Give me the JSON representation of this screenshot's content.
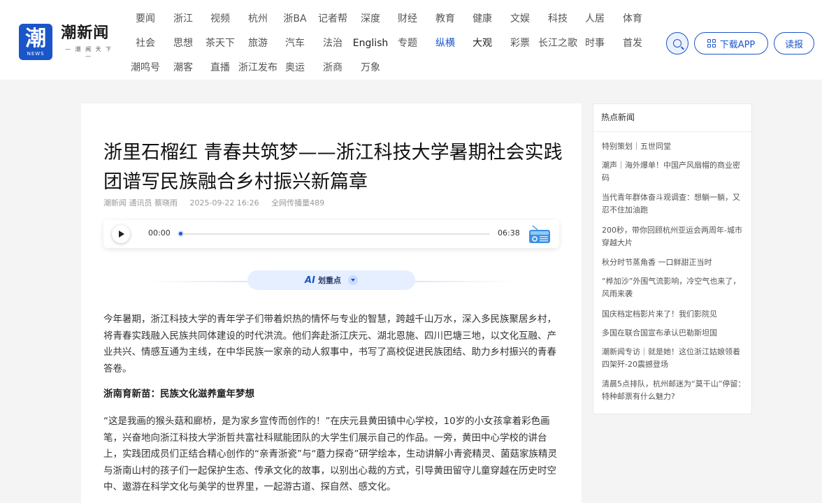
{
  "brand": {
    "logo_glyph": "潮",
    "logo_badge": "NEWS",
    "name": "潮新闻",
    "slogan": "— 潮 闻 天 下 —",
    "accent": "#1a55c9"
  },
  "nav": {
    "row1": [
      "要闻",
      "浙江",
      "视频",
      "杭州",
      "浙BA",
      "记者帮",
      "深度",
      "财经",
      "教育",
      "健康",
      "文娱",
      "科技",
      "人居",
      "体育"
    ],
    "row2": [
      "社会",
      "思想",
      "茶天下",
      "旅游",
      "汽车",
      "法治",
      "English",
      "专题",
      "纵横",
      "大观",
      "彩票",
      "长江之歌",
      "时事",
      "首发"
    ],
    "row3": [
      "潮鸣号",
      "潮客",
      "直播",
      "浙江发布",
      "奥运",
      "浙商",
      "万象"
    ],
    "active": "纵横"
  },
  "header_actions": {
    "download_label": "下载APP",
    "read_label": "读报"
  },
  "article": {
    "title": "浙里石榴红 青春共筑梦——浙江科技大学暑期社会实践团谱写民族融合乡村振兴新篇章",
    "source": "潮新闻 通讯员 蔡晓雨",
    "time": "2025-09-22 16:26",
    "reach": "全网传播量489",
    "audio": {
      "current": "00:00",
      "duration": "06:38",
      "progress": 0
    },
    "ai_label": "划重点",
    "ai_mark": "AI",
    "para1": "今年暑期，浙江科技大学的青年学子们带着炽热的情怀与专业的智慧，跨越千山万水，深入多民族聚居乡村，将青春实践融入民族共同体建设的时代洪流。他们奔赴浙江庆元、湖北恩施、四川巴塘三地，以文化互融、产业共兴、情感互通为主线，在中华民族一家亲的动人叙事中，书写了高校促进民族团结、助力乡村振兴的青春答卷。",
    "subhead1": "浙南育新苗：民族文化滋养童年梦想",
    "para2": "“这是我画的猴头菇和廊桥，是为家乡宣传而创作的！”在庆元县黄田镇中心学校，10岁的小女孩拿着彩色画笔，兴奋地向浙江科技大学浙哲共富社科赋能团队的大学生们展示自己的作品。一旁，黄田中心学校的讲台上，实践团成员们正结合精心创作的“亲青浙瓷”与“蘑力探奇”研学绘本，生动讲解小青瓷精灵、菌菇家族精灵与浙南山村的孩子们一起保护生态、传承文化的故事，以别出心裁的方式，引导黄田留守儿童穿越在历史时空中、遨游在科学文化与美学的世界里，一起游古道、探自然、感文化。"
  },
  "sidebar": {
    "title": "热点新闻",
    "items": [
      "特别策划｜五世同堂",
      "潮声｜海外爆单！中国产风扇帽的商业密码",
      "当代青年群体奋斗观调查：想躺一躺，又忍不住加油跑",
      "200秒，带你回顾杭州亚运会两周年-城市穿越大片",
      "秋分时节蒸角香 一口鲜甜正当时",
      "“桦加沙”外围气流影响，冷空气也来了，风雨来袭",
      "国庆档定档影片来了！我们影院见",
      "多国在联合国宣布承认巴勒斯坦国",
      "潮新闻专访｜就是她！这位浙江姑娘领着四架歼-20震撼登场",
      "清晨5点排队，杭州邮迷为“莫干山”停留：特种邮票有什么魅力?"
    ]
  }
}
